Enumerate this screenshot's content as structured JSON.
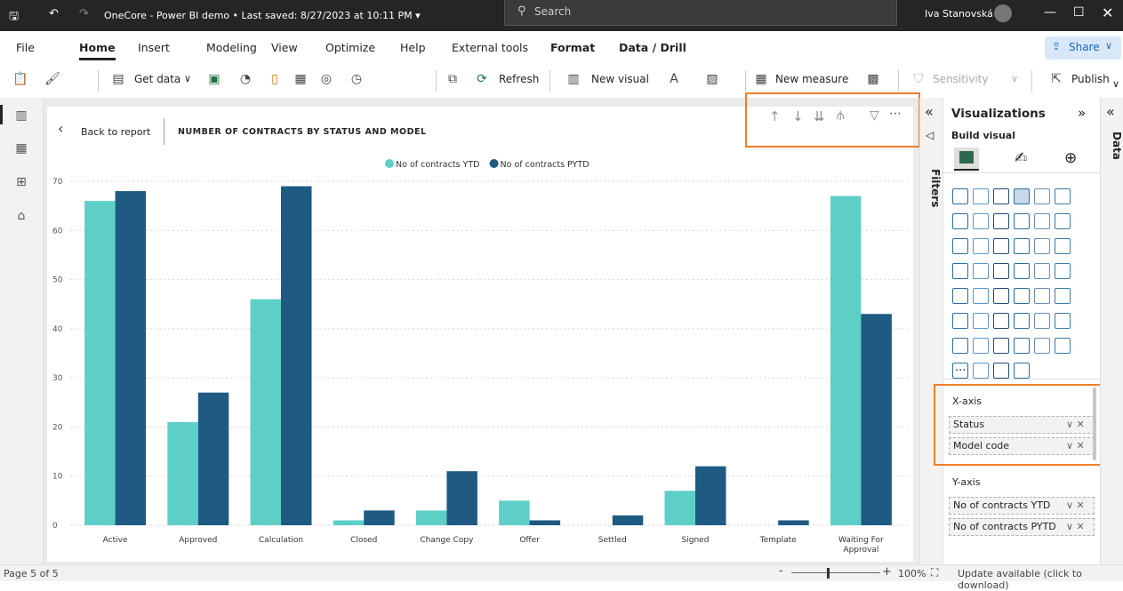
{
  "titlebar": {
    "doc_title": "OneCore - Power BI demo • Last saved: 8/27/2023 at 10:11 PM ▾",
    "search_label": "Search",
    "user_name": "Iva Stanovská"
  },
  "ribbon_tabs": [
    "File",
    "Home",
    "Insert",
    "Modeling",
    "View",
    "Optimize",
    "Help",
    "External tools",
    "Format",
    "Data / Drill"
  ],
  "active_tab": "Home",
  "share_label": "Share",
  "toolbar": {
    "get_data": "Get data",
    "refresh": "Refresh",
    "new_visual": "New visual",
    "new_measure": "New measure",
    "sensitivity": "Sensitivity",
    "publish": "Publish"
  },
  "visual": {
    "back_label": "Back to report",
    "title": "NUMBER OF CONTRACTS BY STATUS AND MODEL"
  },
  "chart_data": {
    "type": "bar",
    "title": "NUMBER OF CONTRACTS BY STATUS AND MODEL",
    "categories": [
      "Active",
      "Approved",
      "Calculation",
      "Closed",
      "Change Copy",
      "Offer",
      "Settled",
      "Signed",
      "Template",
      "Waiting For Approval"
    ],
    "series": [
      {
        "name": "No of contracts YTD",
        "color": "#5ecfc6",
        "values": [
          66,
          21,
          46,
          1,
          3,
          5,
          0,
          7,
          0,
          67
        ]
      },
      {
        "name": "No of contracts PYTD",
        "color": "#1e5a82",
        "values": [
          68,
          27,
          69,
          3,
          11,
          1,
          2,
          12,
          1,
          43
        ]
      }
    ],
    "ylim": [
      0,
      70
    ],
    "yticks": [
      0,
      10,
      20,
      30,
      40,
      50,
      60,
      70
    ],
    "legend": "top-center",
    "grid": true
  },
  "filters_label": "Filters",
  "viz_pane": {
    "title": "Visualizations",
    "build_visual": "Build visual",
    "more": "...",
    "xaxis_label": "X-axis",
    "xaxis_fields": [
      "Status",
      "Model code"
    ],
    "yaxis_label": "Y-axis",
    "yaxis_fields": [
      "No of contracts YTD",
      "No of contracts PYTD"
    ]
  },
  "data_label": "Data",
  "statusbar": {
    "page": "Page 5 of 5",
    "zoom": "100%",
    "update": "Update available (click to download)"
  }
}
